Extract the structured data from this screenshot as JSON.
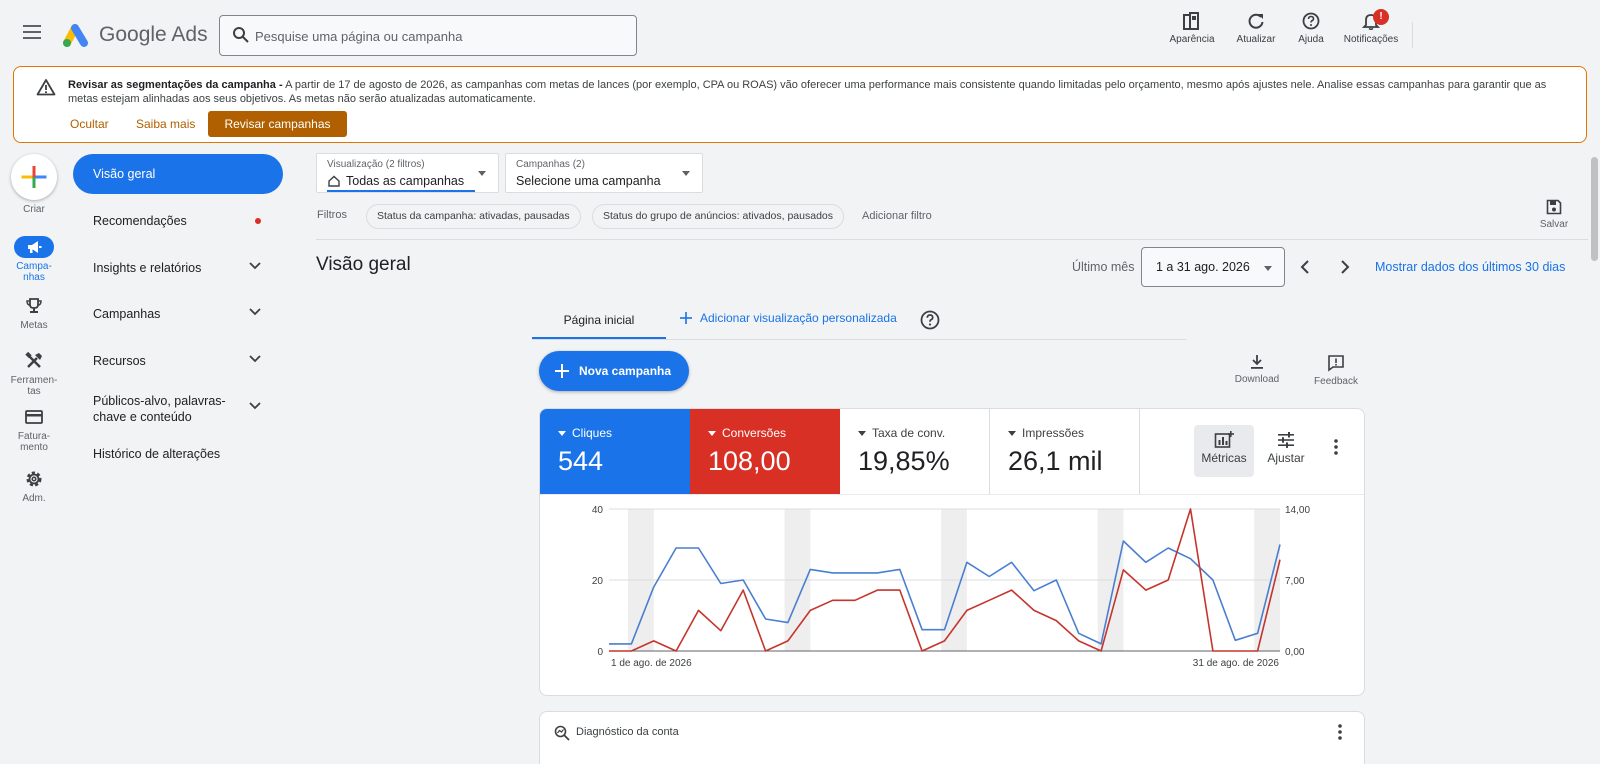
{
  "header": {
    "brand": "Google Ads",
    "search_placeholder": "Pesquise uma página ou campanha",
    "tools": {
      "appearance": "Aparência",
      "refresh": "Atualizar",
      "help": "Ajuda",
      "notifications": "Notificações"
    },
    "notification_badge": "!"
  },
  "banner": {
    "title": "Revisar as segmentações da campanha -",
    "text": "A partir de 17 de agosto de 2026, as campanhas com metas de lances (por exemplo, CPA ou ROAS) vão oferecer uma performance mais consistente quando limitadas pelo orçamento, mesmo após ajustes nele. Analise essas campanhas para garantir que as metas estejam alinhadas aos seus objetivos. As metas não serão atualizadas automaticamente.",
    "hide": "Ocultar",
    "learn_more": "Saiba mais",
    "review": "Revisar campanhas"
  },
  "rail": {
    "create": "Criar",
    "campaigns": "Campa-\nnhas",
    "goals": "Metas",
    "tools": "Ferramen-\ntas",
    "billing": "Fatura-\nmento",
    "admin": "Adm."
  },
  "nav": {
    "overview": "Visão geral",
    "recommendations": "Recomendações",
    "insights": "Insights e relatórios",
    "campaigns": "Campanhas",
    "resources": "Recursos",
    "audiences": "Públicos-alvo, palavras-\nchave e conteúdo",
    "history": "Histórico de alterações"
  },
  "selectors": {
    "view_small": "Visualização (2 filtros)",
    "view_value": "Todas as campanhas",
    "campaign_small": "Campanhas (2)",
    "campaign_value": "Selecione uma campanha"
  },
  "filters": {
    "label": "Filtros",
    "chip1": "Status da campanha: ativadas, pausadas",
    "chip2": "Status do grupo de anúncios: ativados, pausados",
    "add": "Adicionar filtro",
    "save": "Salvar"
  },
  "overview": {
    "title": "Visão geral",
    "period_label": "Último mês",
    "date_range": "1 a 31 ago. 2026",
    "show_30": "Mostrar dados dos últimos 30 dias",
    "tab_home": "Página inicial",
    "tab_add": "Adicionar visualização personalizada",
    "new_campaign": "Nova campanha",
    "download": "Download",
    "feedback": "Feedback"
  },
  "metrics": [
    {
      "label": "Cliques",
      "value": "544",
      "color": "#1a73e8"
    },
    {
      "label": "Conversões",
      "value": "108,00",
      "color": "#d93025"
    },
    {
      "label": "Taxa de conv.",
      "value": "19,85%"
    },
    {
      "label": "Impressões",
      "value": "26,1 mil"
    }
  ],
  "card_tools": {
    "metrics": "Métricas",
    "adjust": "Ajustar"
  },
  "diagnostics": {
    "title": "Diagnóstico da conta"
  },
  "chart_data": {
    "type": "line",
    "x_start_label": "1 de ago. de 2026",
    "x_end_label": "31 de ago. de 2026",
    "days": [
      1,
      2,
      3,
      4,
      5,
      6,
      7,
      8,
      9,
      10,
      11,
      12,
      13,
      14,
      15,
      16,
      17,
      18,
      19,
      20,
      21,
      22,
      23,
      24,
      25,
      26,
      27,
      28,
      29,
      30,
      31
    ],
    "y_left_ticks": [
      "0",
      "20",
      "40"
    ],
    "y_left_lim": [
      0,
      40
    ],
    "y_right_ticks": [
      "0,00",
      "7,00",
      "14,00"
    ],
    "y_right_lim": [
      0,
      14
    ],
    "grid": true,
    "series": [
      {
        "name": "Cliques",
        "axis": "left",
        "color": "#4a7fd0",
        "values": [
          2,
          2,
          18,
          29,
          29,
          19,
          20,
          9,
          8,
          23,
          22,
          22,
          22,
          23,
          6,
          6,
          25,
          21,
          25,
          17,
          20,
          5,
          2,
          31,
          25,
          29,
          26,
          20,
          3,
          5,
          30
        ]
      },
      {
        "name": "Conversões",
        "axis": "right",
        "color": "#c5352c",
        "values": [
          0,
          0,
          1,
          0,
          4,
          2,
          6,
          0,
          1,
          4,
          5,
          5,
          6,
          6,
          0,
          1,
          4,
          5,
          6,
          4,
          3,
          1,
          0,
          8,
          6,
          7,
          14,
          0,
          0,
          0,
          9
        ]
      }
    ],
    "weekend_bands": [
      [
        2,
        3
      ],
      [
        9,
        10
      ],
      [
        16,
        17
      ],
      [
        23,
        24
      ],
      [
        30,
        31
      ]
    ]
  }
}
